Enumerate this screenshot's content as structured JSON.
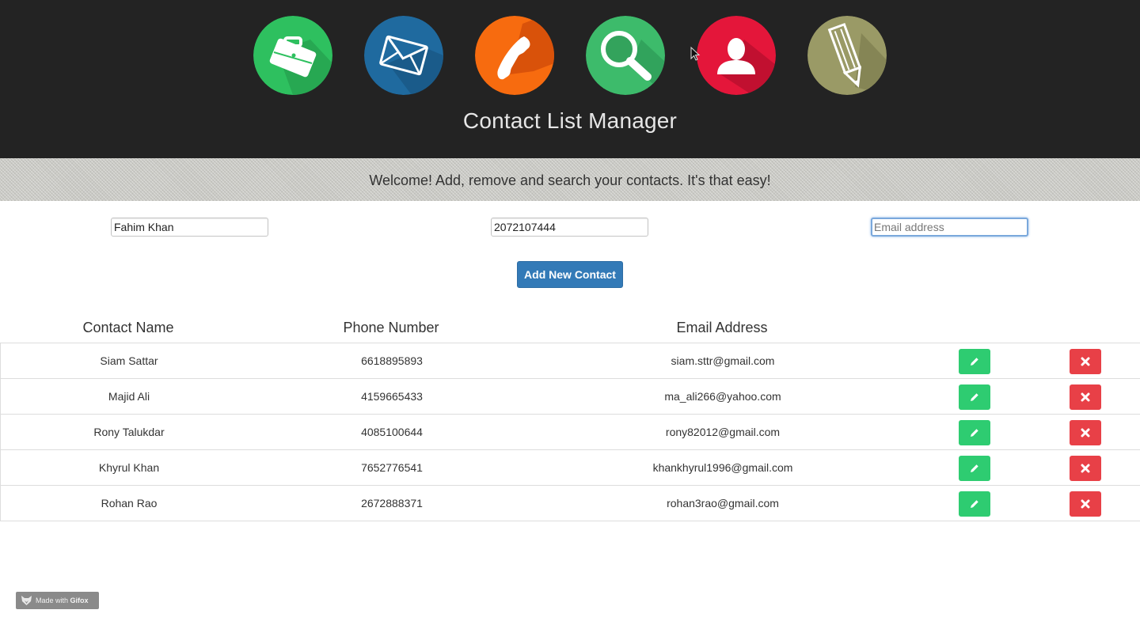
{
  "header": {
    "title": "Contact List Manager",
    "icons": [
      {
        "name": "briefcase-icon",
        "color": "#2ec05f"
      },
      {
        "name": "mail-icon",
        "color": "#1f6a9f"
      },
      {
        "name": "phone-icon",
        "color": "#f76b0f"
      },
      {
        "name": "search-icon",
        "color": "#3dbb6b"
      },
      {
        "name": "user-icon",
        "color": "#e4163a"
      },
      {
        "name": "pencil-icon",
        "color": "#9a9a66"
      }
    ]
  },
  "welcome": {
    "text": "Welcome! Add, remove and search your contacts. It's that easy!"
  },
  "form": {
    "name_value": "Fahim Khan",
    "phone_value": "2072107444",
    "email_placeholder": "Email address",
    "add_label": "Add New Contact"
  },
  "table": {
    "headers": {
      "name": "Contact Name",
      "phone": "Phone Number",
      "email": "Email Address"
    },
    "rows": [
      {
        "name": "Siam Sattar",
        "phone": "6618895893",
        "email": "siam.sttr@gmail.com"
      },
      {
        "name": "Majid Ali",
        "phone": "4159665433",
        "email": "ma_ali266@yahoo.com"
      },
      {
        "name": "Rony Talukdar",
        "phone": "4085100644",
        "email": "rony82012@gmail.com"
      },
      {
        "name": "Khyrul Khan",
        "phone": "7652776541",
        "email": "khankhyrul1996@gmail.com"
      },
      {
        "name": "Rohan Rao",
        "phone": "2672888371",
        "email": "rohan3rao@gmail.com"
      }
    ]
  },
  "watermark": {
    "made_with": "Made with",
    "brand": "Gifox"
  }
}
